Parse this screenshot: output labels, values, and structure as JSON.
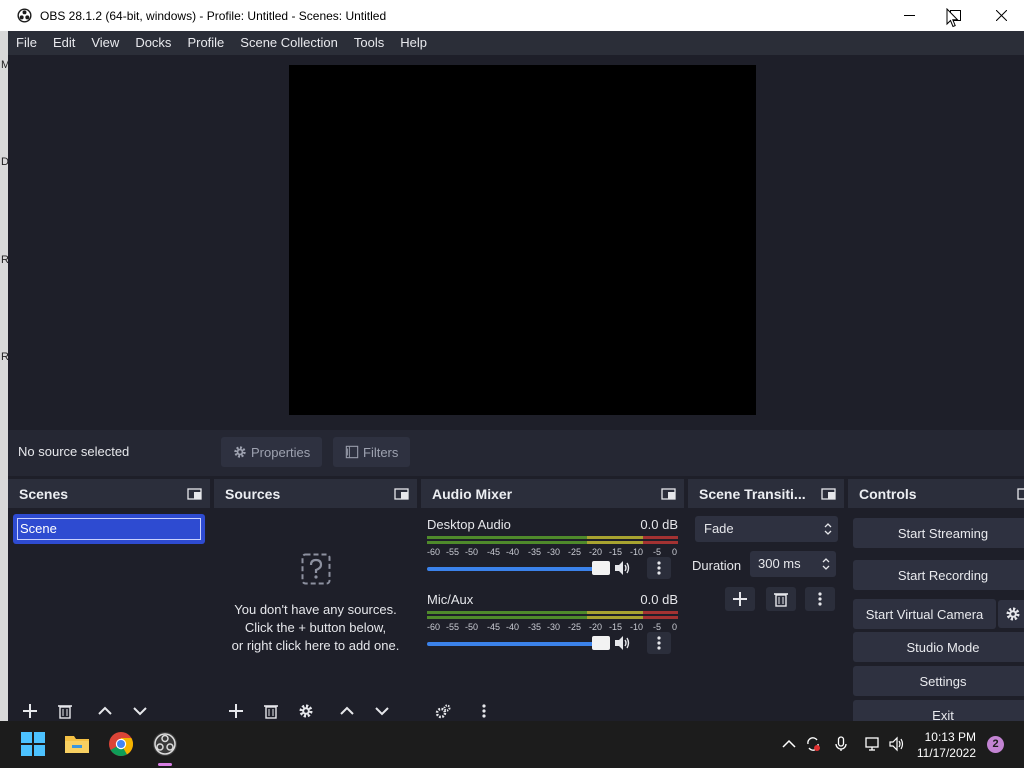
{
  "window": {
    "title": "OBS 28.1.2 (64-bit, windows) - Profile: Untitled - Scenes: Untitled"
  },
  "menu": [
    "File",
    "Edit",
    "View",
    "Docks",
    "Profile",
    "Scene Collection",
    "Tools",
    "Help"
  ],
  "left_strip_letters": [
    "M",
    "D",
    "R",
    "R"
  ],
  "context_bar": {
    "status": "No source selected",
    "properties_label": "Properties",
    "filters_label": "Filters"
  },
  "docks": {
    "scenes": {
      "title": "Scenes",
      "items": [
        "Scene"
      ],
      "selected": "Scene"
    },
    "sources": {
      "title": "Sources",
      "empty_line1": "You don't have any sources.",
      "empty_line2": "Click the + button below,",
      "empty_line3": "or right click here to add one."
    },
    "audio_mixer": {
      "title": "Audio Mixer",
      "channels": [
        {
          "name": "Desktop Audio",
          "db": "0.0 dB",
          "volume": 1.0
        },
        {
          "name": "Mic/Aux",
          "db": "0.0 dB",
          "volume": 1.0
        }
      ],
      "ticks": [
        "-60",
        "-55",
        "-50",
        "-45",
        "-40",
        "-35",
        "-30",
        "-25",
        "-20",
        "-15",
        "-10",
        "-5",
        "0"
      ]
    },
    "transitions": {
      "title": "Scene Transiti...",
      "selected": "Fade",
      "duration_label": "Duration",
      "duration_value": "300 ms"
    },
    "controls": {
      "title": "Controls",
      "start_streaming": "Start Streaming",
      "start_recording": "Start Recording",
      "start_virtual_camera": "Start Virtual Camera",
      "studio_mode": "Studio Mode",
      "settings": "Settings",
      "exit": "Exit"
    }
  },
  "taskbar": {
    "time": "10:13 PM",
    "date": "11/17/2022",
    "notifications": "2"
  },
  "colors": {
    "accent": "#2e4bd1",
    "slider": "#3b82ea",
    "meter_green": "#4f8a2b",
    "meter_yellow": "#a8a330",
    "meter_red": "#a33232",
    "badge": "#c384d3"
  }
}
